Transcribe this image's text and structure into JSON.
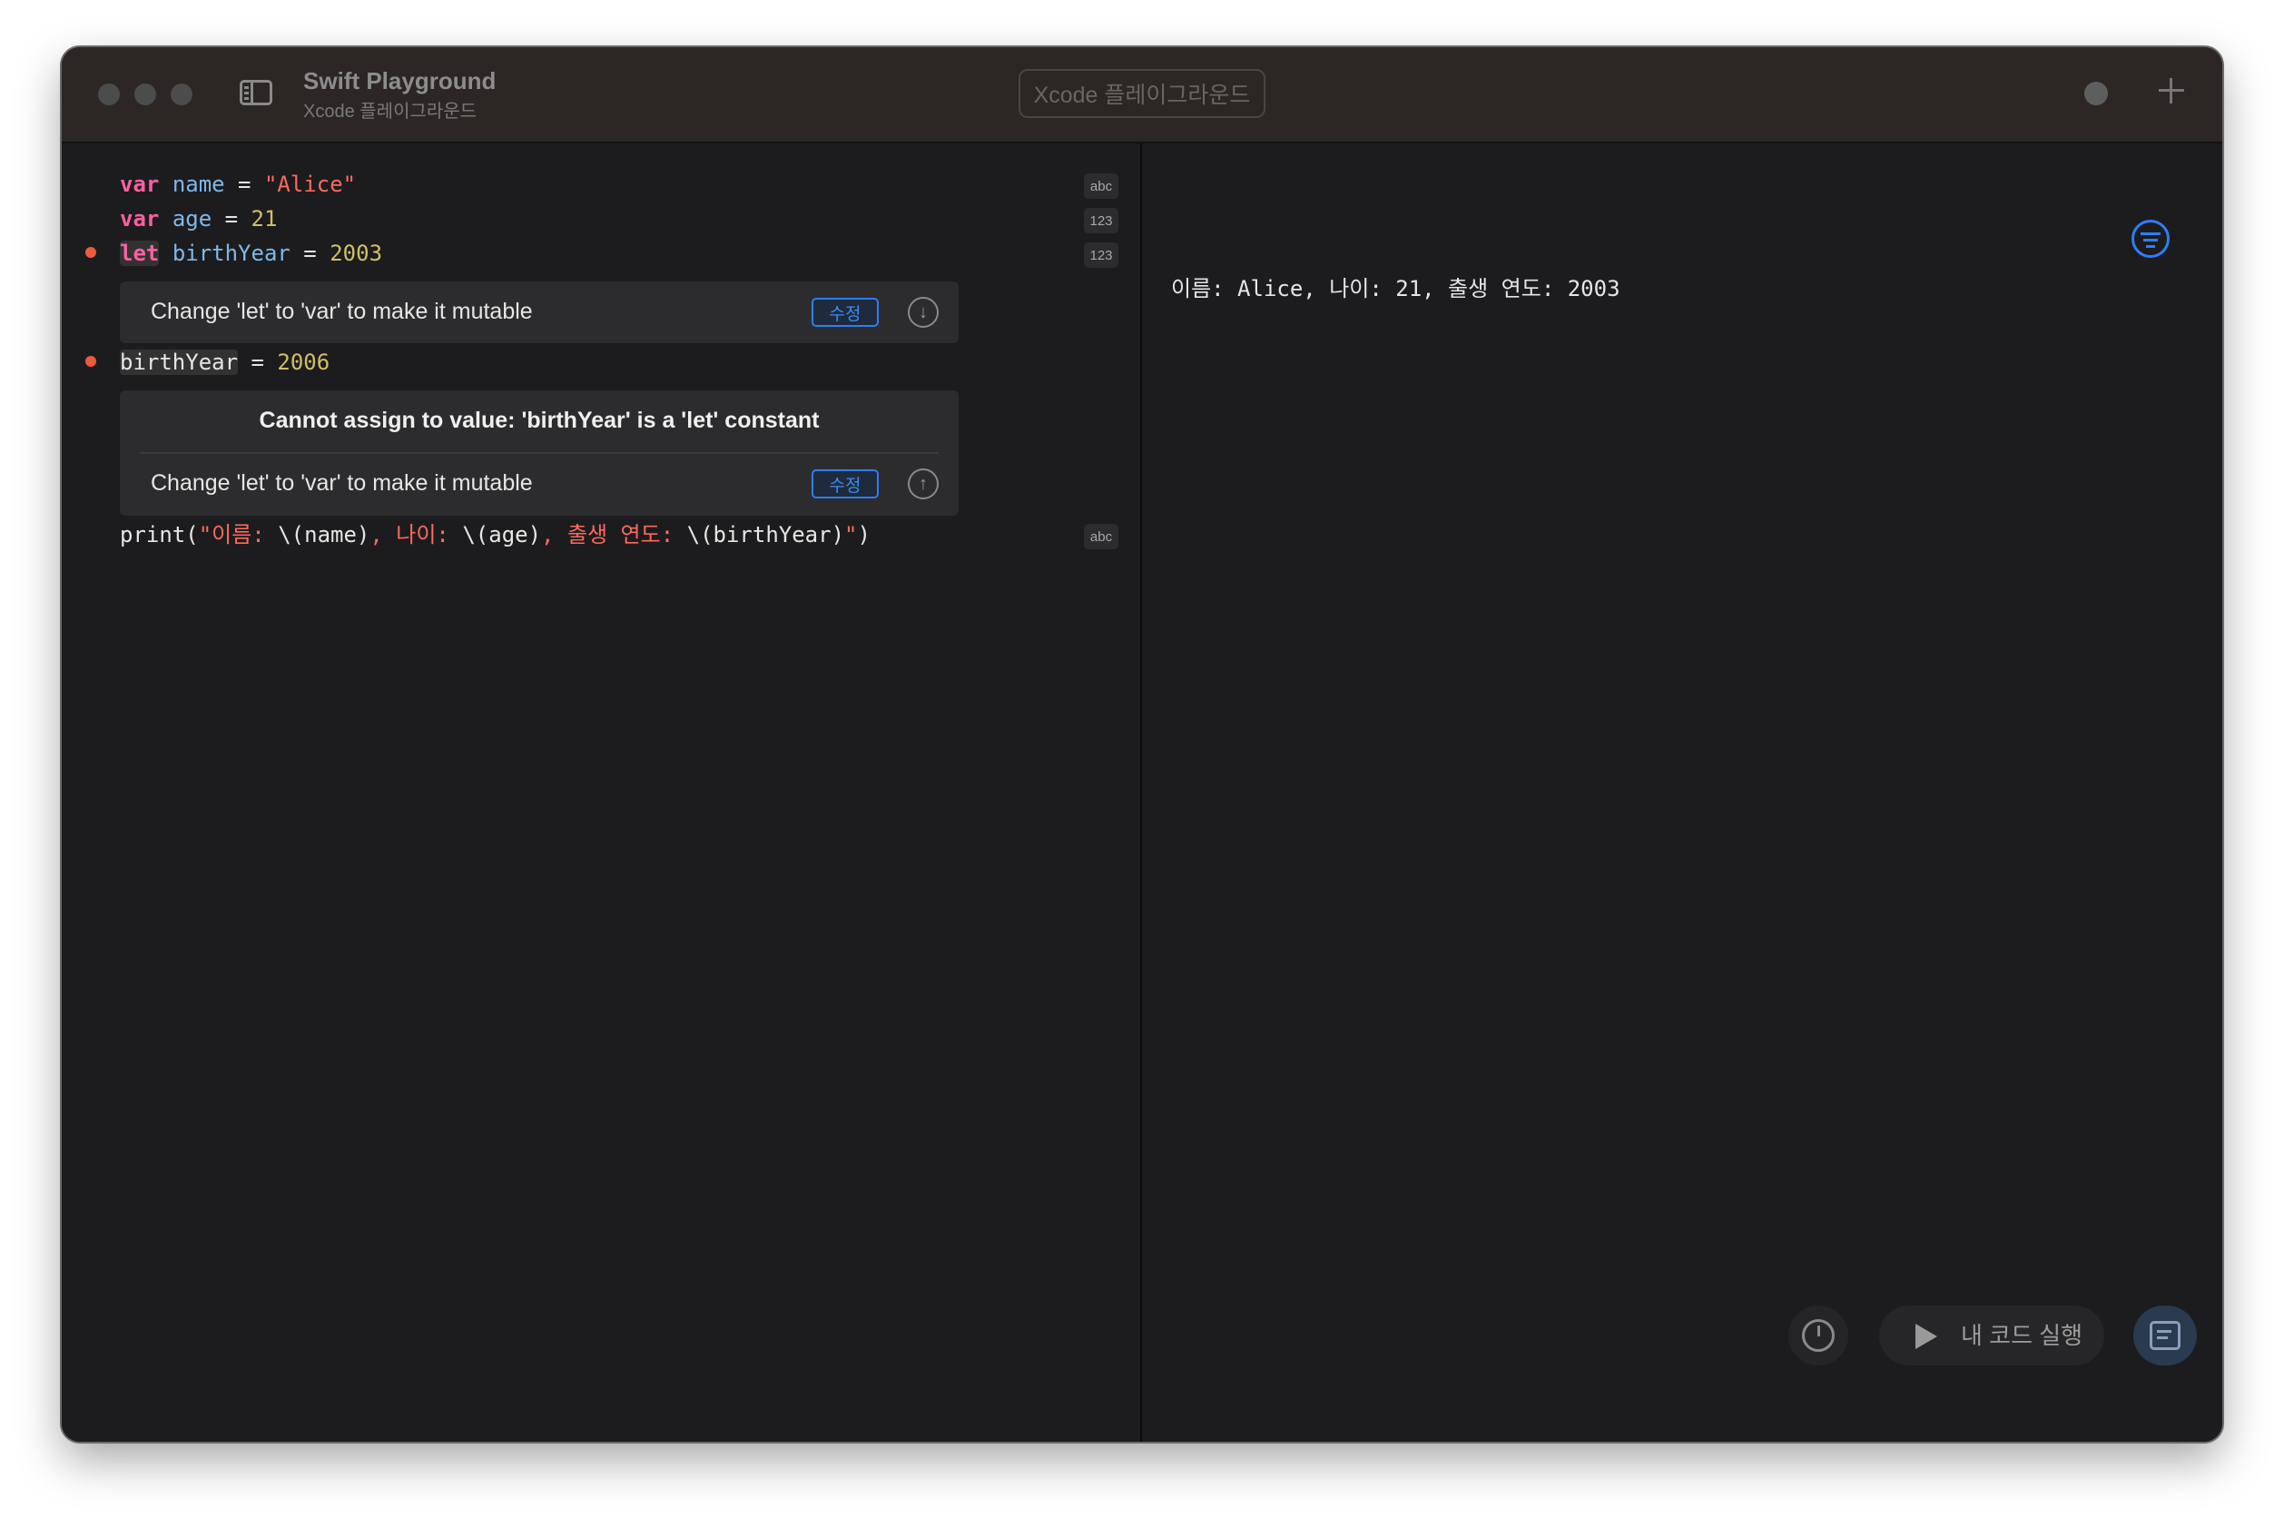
{
  "window": {
    "title": "Swift Playground",
    "subtitle": "Xcode 플레이그라운드",
    "search_placeholder": "Xcode 플레이그라운드"
  },
  "editor": {
    "line1": {
      "kw": "var",
      "name": "name",
      "eq": " = ",
      "value": "\"Alice\"",
      "badge": "abc"
    },
    "line2": {
      "kw": "var",
      "name": "age",
      "eq": " = ",
      "value": "21",
      "badge": "123"
    },
    "line3": {
      "kw": "let",
      "name": "birthYear",
      "eq": " = ",
      "value": "2003",
      "badge": "123"
    },
    "fix1": {
      "text": "Change 'let' to 'var' to make it mutable",
      "button": "수정"
    },
    "line4": {
      "name": "birthYear",
      "eq": " = ",
      "value": "2006"
    },
    "error": {
      "message": "Cannot assign to value: 'birthYear' is a 'let' constant",
      "fix_text": "Change 'let' to 'var' to make it mutable",
      "button": "수정"
    },
    "line5": {
      "p1": "print(",
      "s1": "\"이름: ",
      "i1": "\\(name)",
      "s2": ", 나이: ",
      "i2": "\\(age)",
      "s3": ", 출생 연도: ",
      "i3": "\\(birthYear)",
      "s4": "\"",
      "p2": ")",
      "badge": "abc"
    }
  },
  "results": {
    "output": "이름: Alice, 나이: 21, 출생 연도: 2003"
  },
  "toolbar": {
    "run_label": "내 코드 실행"
  },
  "colors": {
    "keyword": "#fc5fa3",
    "identifier": "#7fb8ea",
    "string": "#fc6a5d",
    "number": "#d0bf69",
    "accent": "#2d7ef7",
    "error_dot": "#f05a3c"
  },
  "icons": [
    "sidebar-toggle-icon",
    "record-icon",
    "plus-icon",
    "filter-icon",
    "timer-icon",
    "play-icon",
    "console-icon",
    "arrow-down-icon",
    "arrow-up-icon"
  ]
}
